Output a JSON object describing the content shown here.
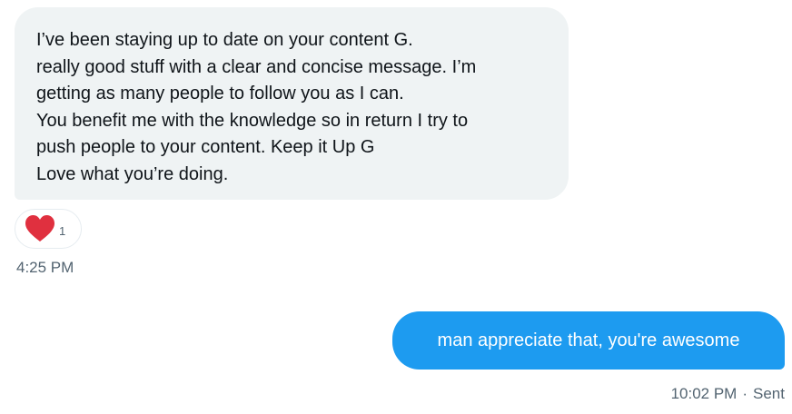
{
  "received_message": {
    "lines": [
      "I’ve been staying up to date on your content G.",
      "really good stuff with a clear and concise message. I’m",
      "getting as many people to follow you as I can.",
      "You benefit me with the knowledge so in return I try to",
      "push people to your content. Keep it Up G",
      "Love what you’re doing."
    ],
    "reaction": {
      "icon": "heart-icon",
      "color": "#e0303f",
      "count": "1"
    },
    "time": "4:25 PM"
  },
  "sent_message": {
    "text": "man appreciate that, you're awesome",
    "time": "10:02 PM",
    "separator": "·",
    "status": "Sent"
  },
  "colors": {
    "received_bubble": "#eff3f4",
    "sent_bubble": "#1d9bf0",
    "meta_text": "#536471"
  }
}
